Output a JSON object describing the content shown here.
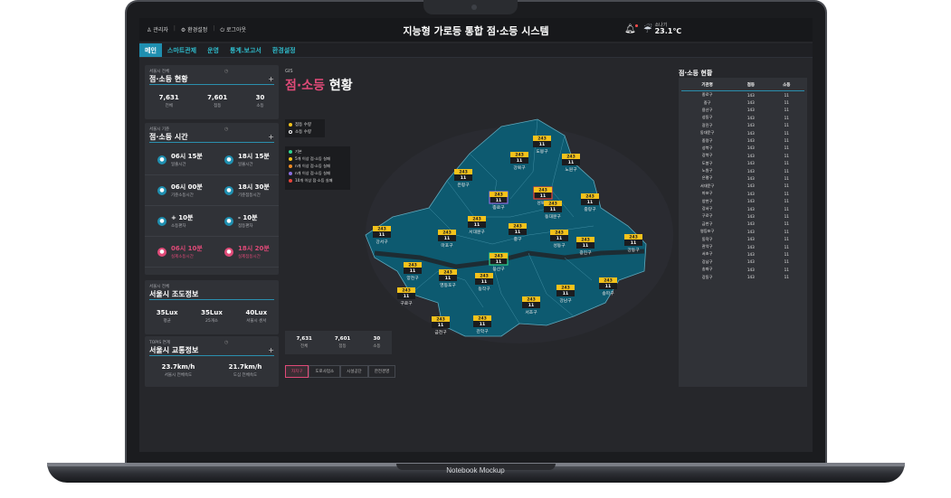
{
  "mockup_label": "Notebook Mockup",
  "topbar": {
    "user": "관리자",
    "settings": "환경설정",
    "logout": "로그아웃",
    "title": "지능형 가로등 통합 점·소등 시스템",
    "weather_label": "소나기",
    "weather_temp": "23.1℃"
  },
  "tabs": [
    "메인",
    "스마트관제",
    "운영",
    "통계.보고서",
    "환경설정"
  ],
  "panel_onoff": {
    "sub": "서울시 전체",
    "title": "점·소등 현황",
    "stats": [
      {
        "value": "7,631",
        "label": "전체"
      },
      {
        "value": "7,601",
        "label": "점등"
      },
      {
        "value": "30",
        "label": "소등"
      }
    ]
  },
  "panel_time": {
    "sub": "서울시 기준",
    "title": "점·소등 시간",
    "cells": [
      {
        "value": "06시 15분",
        "label": "일출시간",
        "icon": "sun-icon",
        "accent": false
      },
      {
        "value": "18시 15분",
        "label": "일몰시간",
        "icon": "sunset-icon",
        "accent": false
      },
      {
        "value": "06시 00분",
        "label": "기준소등시간",
        "icon": "lamp-off-icon",
        "accent": false
      },
      {
        "value": "18시 30분",
        "label": "기준점등시간",
        "icon": "lamp-on-icon",
        "accent": false
      },
      {
        "value": "+ 10분",
        "label": "소등편차",
        "icon": "plus-icon",
        "accent": false
      },
      {
        "value": "- 10분",
        "label": "점등편차",
        "icon": "minus-icon",
        "accent": false
      },
      {
        "value": "06시 10분",
        "label": "실제소등시간",
        "icon": "lamp-off-icon",
        "accent": true
      },
      {
        "value": "18시 20분",
        "label": "실제점등시간",
        "icon": "lamp-on-icon",
        "accent": true
      }
    ]
  },
  "panel_lux": {
    "sub": "서울시 전체",
    "title": "서울시 조도정보",
    "stats": [
      {
        "value": "35Lux",
        "label": "평균"
      },
      {
        "value": "35Lux",
        "label": "25개소"
      },
      {
        "value": "40Lux",
        "label": "서울시 센서"
      }
    ]
  },
  "panel_traffic": {
    "sub": "TOPIS 연계",
    "title": "서울시 교통정보",
    "stats": [
      {
        "value": "23.7km/h",
        "label": "서울시 전체속도"
      },
      {
        "value": "21.7km/h",
        "label": "도심 전체속도"
      }
    ]
  },
  "gis": {
    "sub": "GIS",
    "title_pink": "점·소등",
    "title_white": " 현황",
    "legend1": [
      "점등 수량",
      "소등 수량"
    ],
    "legend2": [
      "기본",
      "5개 이상 점·소등 실패",
      "n개 이상 점·소등 실패",
      "n개 이상 점·소등 실패",
      "10개 이상 점·소등 실패"
    ],
    "bottom_stats": [
      {
        "value": "7,631",
        "label": "전체"
      },
      {
        "value": "7,601",
        "label": "점등"
      },
      {
        "value": "30",
        "label": "소등"
      }
    ],
    "filters": [
      "자치구",
      "도로사업소",
      "시설공단",
      "한전경영"
    ],
    "districts": [
      {
        "name": "도봉구",
        "on": "243",
        "off": "11"
      },
      {
        "name": "강북구",
        "on": "243",
        "off": "11"
      },
      {
        "name": "노원구",
        "on": "243",
        "off": "11"
      },
      {
        "name": "은평구",
        "on": "243",
        "off": "11"
      },
      {
        "name": "성북구",
        "on": "243",
        "off": "11"
      },
      {
        "name": "종로구",
        "on": "243",
        "off": "11"
      },
      {
        "name": "동대문구",
        "on": "243",
        "off": "11"
      },
      {
        "name": "중랑구",
        "on": "243",
        "off": "11"
      },
      {
        "name": "서대문구",
        "on": "243",
        "off": "11"
      },
      {
        "name": "강서구",
        "on": "243",
        "off": "11"
      },
      {
        "name": "마포구",
        "on": "243",
        "off": "11"
      },
      {
        "name": "중구",
        "on": "243",
        "off": "11"
      },
      {
        "name": "성동구",
        "on": "243",
        "off": "11"
      },
      {
        "name": "광진구",
        "on": "243",
        "off": "11"
      },
      {
        "name": "강동구",
        "on": "243",
        "off": "11"
      },
      {
        "name": "용산구",
        "on": "243",
        "off": "11"
      },
      {
        "name": "양천구",
        "on": "243",
        "off": "11"
      },
      {
        "name": "영등포구",
        "on": "243",
        "off": "11"
      },
      {
        "name": "동작구",
        "on": "243",
        "off": "11"
      },
      {
        "name": "송파구",
        "on": "243",
        "off": "11"
      },
      {
        "name": "강남구",
        "on": "243",
        "off": "11"
      },
      {
        "name": "구로구",
        "on": "243",
        "off": "11"
      },
      {
        "name": "서초구",
        "on": "243",
        "off": "11"
      },
      {
        "name": "금천구",
        "on": "243",
        "off": "11"
      },
      {
        "name": "관악구",
        "on": "243",
        "off": "11"
      }
    ]
  },
  "right_table": {
    "title": "점·소등 현황",
    "headers": [
      "기관명",
      "점등",
      "소등"
    ],
    "rows": [
      [
        "종로구",
        "143",
        "11"
      ],
      [
        "중구",
        "143",
        "11"
      ],
      [
        "용산구",
        "143",
        "11"
      ],
      [
        "성동구",
        "143",
        "11"
      ],
      [
        "광진구",
        "143",
        "11"
      ],
      [
        "동대문구",
        "143",
        "11"
      ],
      [
        "중랑구",
        "143",
        "11"
      ],
      [
        "성북구",
        "143",
        "11"
      ],
      [
        "강북구",
        "143",
        "11"
      ],
      [
        "도봉구",
        "143",
        "11"
      ],
      [
        "노원구",
        "143",
        "11"
      ],
      [
        "은평구",
        "143",
        "11"
      ],
      [
        "서대문구",
        "143",
        "11"
      ],
      [
        "마포구",
        "143",
        "11"
      ],
      [
        "양천구",
        "143",
        "11"
      ],
      [
        "강서구",
        "143",
        "11"
      ],
      [
        "구로구",
        "143",
        "11"
      ],
      [
        "금천구",
        "143",
        "11"
      ],
      [
        "영등포구",
        "143",
        "11"
      ],
      [
        "동작구",
        "143",
        "11"
      ],
      [
        "관악구",
        "143",
        "11"
      ],
      [
        "서초구",
        "143",
        "11"
      ],
      [
        "강남구",
        "143",
        "11"
      ],
      [
        "송파구",
        "143",
        "11"
      ],
      [
        "강동구",
        "143",
        "11"
      ]
    ]
  },
  "colors": {
    "accent_teal": "#1f8fb0",
    "accent_pink": "#e04a78",
    "map_fill": "#0d5a70",
    "badge_yellow": "#f4c21b"
  }
}
